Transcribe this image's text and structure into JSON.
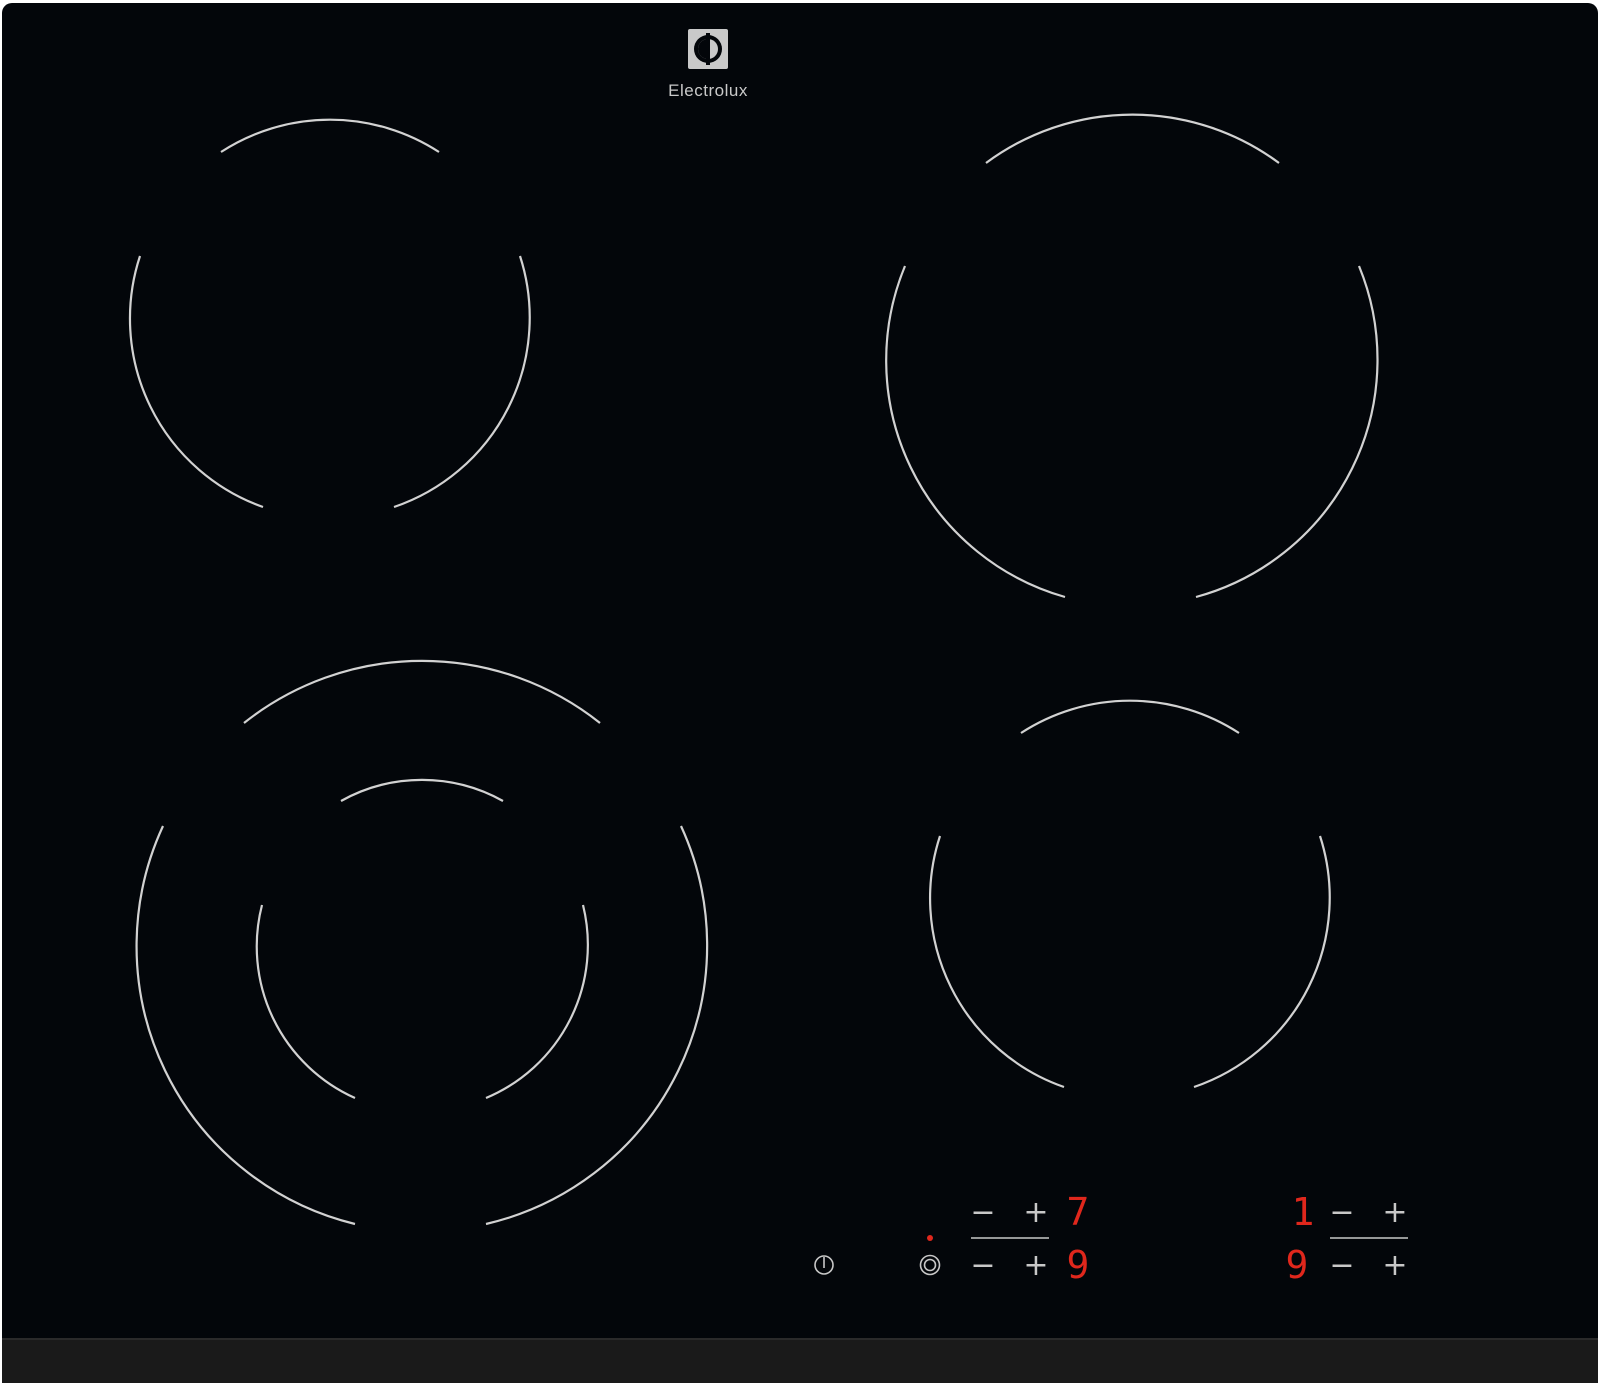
{
  "brand": {
    "name": "Electrolux",
    "logo_icon": "electrolux-logo-icon"
  },
  "colors": {
    "glass": "#03060a",
    "ring": "#d2d2d2",
    "display_red": "#e0271c",
    "control_gray": "#c8c8c8",
    "frame_bottom": "#1a1a1a"
  },
  "cooking_zones": [
    {
      "id": "rear-left",
      "type": "single"
    },
    {
      "id": "rear-right",
      "type": "single"
    },
    {
      "id": "front-left",
      "type": "dual"
    },
    {
      "id": "front-right",
      "type": "single"
    }
  ],
  "controls": {
    "power_icon": "power-icon",
    "dual_zone_icon": "dual-zone-icon",
    "minus_label": "−",
    "plus_label": "+",
    "left_panel": {
      "top_level": "7",
      "bottom_level": "9"
    },
    "right_panel": {
      "top_level": "1",
      "bottom_level": "9"
    }
  }
}
